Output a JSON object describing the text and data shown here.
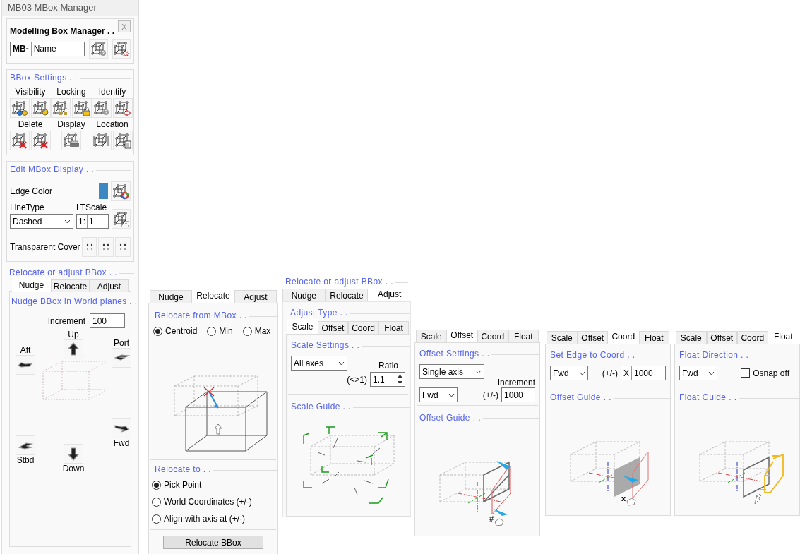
{
  "window": {
    "title": "MB03 MBox Manager"
  },
  "manager": {
    "title": "Modelling Box Manager . .",
    "close_label": "X",
    "prefix": "MB-",
    "name_value": "Name"
  },
  "bbox_settings": {
    "title": "BBox Settings . .",
    "groups": [
      {
        "label": "Visibility"
      },
      {
        "label": "Locking"
      },
      {
        "label": "Identify"
      },
      {
        "label": "Delete"
      },
      {
        "label": "Display"
      },
      {
        "label": "Location"
      }
    ]
  },
  "edit_display": {
    "title": "Edit MBox Display . .",
    "edge_color": {
      "label": "Edge Color",
      "color": "#3d87c2"
    },
    "line_type": {
      "label": "LineType",
      "value": "Dashed"
    },
    "lt_scale": {
      "label": "LTScale",
      "prefix": "1:",
      "value": "1"
    },
    "transparent_cover": {
      "label": "Transparent Cover"
    }
  },
  "relocate_adjust": {
    "title": "Relocate or adjust BBox . .",
    "tabs": [
      {
        "label": "Nudge",
        "selected": true
      },
      {
        "label": "Relocate",
        "selected": false
      },
      {
        "label": "Adjust",
        "selected": false
      }
    ],
    "nudge": {
      "title": "Nudge BBox in World planes . .",
      "increment": {
        "label": "Increment",
        "value": "100"
      },
      "directions": [
        {
          "label": "Up"
        },
        {
          "label": "Port"
        },
        {
          "label": "Aft"
        },
        {
          "label": "Fwd"
        },
        {
          "label": "Stbd"
        },
        {
          "label": "Down"
        }
      ]
    }
  },
  "relocate_panel": {
    "tabs": [
      {
        "label": "Nudge",
        "selected": false
      },
      {
        "label": "Relocate",
        "selected": true
      },
      {
        "label": "Adjust",
        "selected": false
      }
    ],
    "from": {
      "title": "Relocate from MBox . .",
      "options": [
        {
          "label": "Centroid",
          "selected": true
        },
        {
          "label": "Min",
          "selected": false
        },
        {
          "label": "Max",
          "selected": false
        }
      ]
    },
    "to": {
      "title": "Relocate to . .",
      "options": [
        {
          "label": "Pick Point",
          "selected": true
        },
        {
          "label": "World Coordinates (+/-)",
          "selected": false
        },
        {
          "label": "Align with axis at (+/-)",
          "selected": false
        }
      ]
    },
    "button": "Relocate BBox"
  },
  "adjust_panel": {
    "title": "Relocate or adjust BBox . .",
    "tabs": [
      {
        "label": "Nudge",
        "selected": false
      },
      {
        "label": "Relocate",
        "selected": false
      },
      {
        "label": "Adjust",
        "selected": true
      }
    ],
    "type_title": "Adjust Type . ."
  },
  "adjust_views": [
    {
      "kind": "scale",
      "tabs": [
        {
          "label": "Scale",
          "selected": true
        },
        {
          "label": "Offset",
          "selected": false
        },
        {
          "label": "Coord",
          "selected": false
        },
        {
          "label": "Float",
          "selected": false
        }
      ],
      "settings_title": "Scale Settings . .",
      "mode": "All axes",
      "ratio_label": "Ratio",
      "ratio_hint": "(<>1)",
      "ratio_value": "1.1",
      "guide_title": "Scale Guide . ."
    },
    {
      "kind": "offset",
      "tabs": [
        {
          "label": "Scale",
          "selected": false
        },
        {
          "label": "Offset",
          "selected": true
        },
        {
          "label": "Coord",
          "selected": false
        },
        {
          "label": "Float",
          "selected": false
        }
      ],
      "settings_title": "Offset Settings . .",
      "mode": "Single axis",
      "increment_label": "Increment",
      "direction": "Fwd",
      "sign_hint": "(+/-)",
      "value": "1000",
      "guide_title": "Offset Guide . .",
      "cursor_mark": "#"
    },
    {
      "kind": "coord",
      "tabs": [
        {
          "label": "Scale",
          "selected": false
        },
        {
          "label": "Offset",
          "selected": false
        },
        {
          "label": "Coord",
          "selected": true
        },
        {
          "label": "Float",
          "selected": false
        }
      ],
      "settings_title": "Set Edge to Coord . .",
      "direction": "Fwd",
      "sign_hint": "(+/-)",
      "axis": "X",
      "value": "1000",
      "guide_title": "Offset Guide . .",
      "cursor_mark": "x"
    },
    {
      "kind": "float",
      "tabs": [
        {
          "label": "Scale",
          "selected": false
        },
        {
          "label": "Offset",
          "selected": false
        },
        {
          "label": "Coord",
          "selected": false
        },
        {
          "label": "Float",
          "selected": true
        }
      ],
      "settings_title": "Float Direction . .",
      "direction": "Fwd",
      "osnap": {
        "label": "Osnap off",
        "checked": false
      },
      "guide_title": "Float Guide . ."
    }
  ]
}
